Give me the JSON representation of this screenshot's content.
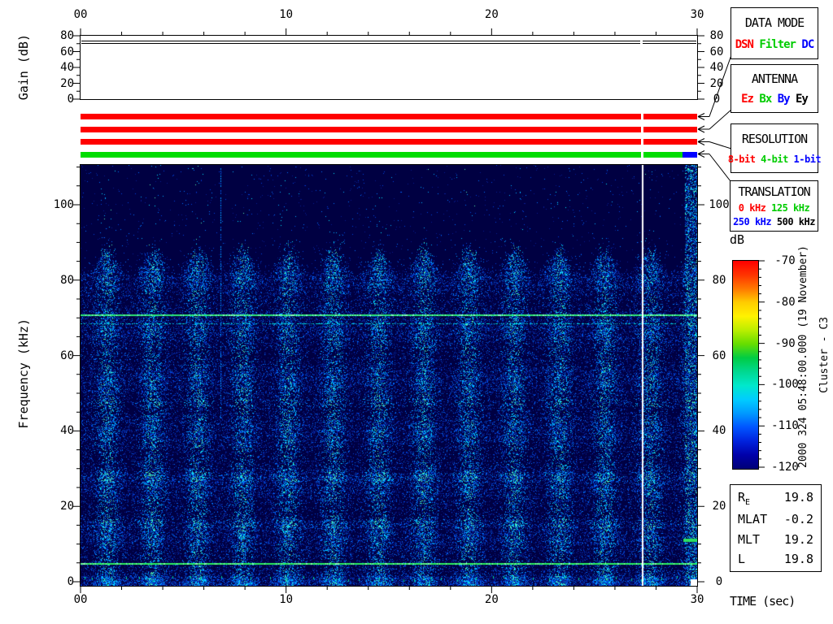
{
  "gain_panel": {
    "ylabel": "Gain (dB)",
    "yticks": [
      "80",
      "60",
      "40",
      "20",
      "0"
    ],
    "gain_trace_db": [
      74,
      70.5
    ]
  },
  "time_axis": {
    "ticks": [
      "00",
      "10",
      "20",
      "30"
    ],
    "range_sec": [
      0,
      30
    ],
    "minor_step_sec": 2
  },
  "mode_bars": {
    "gap_time_sec": 27.3,
    "bars": [
      {
        "name": "data-mode-bar",
        "active": "DSN",
        "color": "#ff0000"
      },
      {
        "name": "antenna-bar",
        "active": "Ez",
        "color": "#ff0000"
      },
      {
        "name": "resolution-bar",
        "active": "8-bit",
        "color": "#ff0000"
      },
      {
        "name": "translation-bar",
        "active": "125 kHz",
        "color": "#00dd00",
        "end_segment": {
          "active": "250 kHz",
          "color": "#0000ff",
          "start_sec": 29.3
        }
      }
    ]
  },
  "info_boxes": {
    "data_mode": {
      "title": "DATA MODE",
      "options": [
        {
          "label": "DSN",
          "color": "#ff0000"
        },
        {
          "label": "Filter",
          "color": "#00cc00"
        },
        {
          "label": "DC",
          "color": "#0000ff"
        }
      ]
    },
    "antenna": {
      "title": "ANTENNA",
      "options": [
        {
          "label": "Ez",
          "color": "#ff0000"
        },
        {
          "label": "Bx",
          "color": "#00cc00"
        },
        {
          "label": "By",
          "color": "#0000ff"
        },
        {
          "label": "Ey",
          "color": "#000000"
        }
      ]
    },
    "resolution": {
      "title": "RESOLUTION",
      "options": [
        {
          "label": "8-bit",
          "color": "#ff0000"
        },
        {
          "label": "4-bit",
          "color": "#00cc00"
        },
        {
          "label": "1-bit",
          "color": "#0000ff"
        }
      ]
    },
    "translation": {
      "title": "TRANSLATION",
      "options": [
        {
          "label": "0 kHz",
          "color": "#ff0000"
        },
        {
          "label": "125 kHz",
          "color": "#00cc00"
        },
        {
          "label": "250 kHz",
          "color": "#0000ff"
        },
        {
          "label": "500 kHz",
          "color": "#000000"
        }
      ]
    }
  },
  "colorbar": {
    "label": "dB",
    "ticks": [
      "-70",
      "-80",
      "-90",
      "-100",
      "-110",
      "-120"
    ],
    "max_db": -70,
    "min_db": -120,
    "gradient": [
      "#ff0000",
      "#ff3300",
      "#ff7700",
      "#ffcc00",
      "#fff200",
      "#bbee00",
      "#66dd00",
      "#00cc44",
      "#00d890",
      "#00e8cc",
      "#00ccff",
      "#0099ff",
      "#0055ff",
      "#0022dd",
      "#0000aa",
      "#000077"
    ]
  },
  "side_annotations": {
    "datetime": "2000 324 05:48:00.000 (19 November)",
    "spacecraft": "Cluster - C3"
  },
  "ephemeris": {
    "rows": [
      {
        "label": "R",
        "subscript": "E",
        "value": "19.8"
      },
      {
        "label": "MLAT",
        "subscript": "",
        "value": "-0.2"
      },
      {
        "label": "MLT",
        "subscript": "",
        "value": "19.2"
      },
      {
        "label": "L",
        "subscript": "",
        "value": "19.8"
      }
    ]
  },
  "spectrogram": {
    "xlabel": "TIME (sec)",
    "ylabel": "Frequency (kHz)",
    "xticks": [
      "00",
      "10",
      "20",
      "30"
    ],
    "yticks": [
      "100",
      "80",
      "60",
      "40",
      "20",
      "0"
    ],
    "background_color": "#000042",
    "white_marker_sec": 27.3
  },
  "chart_data": [
    {
      "type": "line",
      "title": "Receiver gain vs time",
      "xlabel": "TIME (sec)",
      "ylabel": "Gain (dB)",
      "x_range": [
        0,
        30
      ],
      "y_range": [
        0,
        80
      ],
      "series": [
        {
          "name": "gain_db",
          "x": [
            0,
            30
          ],
          "y": [
            74,
            74
          ]
        },
        {
          "name": "gain_db_lower",
          "x": [
            0,
            30
          ],
          "y": [
            70.5,
            70.5
          ]
        }
      ]
    },
    {
      "type": "heatmap",
      "title": "Cluster C3 WBD wideband spectrogram, 2000-324 05:48:00.000 (19 November)",
      "xlabel": "TIME (sec)",
      "ylabel": "Frequency (kHz)",
      "zlabel": "dB",
      "x_range": [
        0,
        30
      ],
      "y_range": [
        0,
        110
      ],
      "z_range": [
        -120,
        -70
      ],
      "features": [
        "broadband impulsive bursts recurring every ~2.2 s filling 0-85 kHz",
        "dark background near -120 dB above ~85 kHz noise ceiling",
        "narrowband emission line at ~71 kHz across all times",
        "weaker narrowband line at ~68.5 kHz",
        "narrowband emission line at ~5 kHz across all times",
        "vertical white marker line at t = 27.3 s",
        "faint vertical interference spike at t = 6.8 s up to 110 kHz",
        "enhanced broadband burst column at t = 29.5-30 s",
        "short emission segment at ~11.5 kHz, t = 29.3-30 s",
        "translation switches 125 kHz -> 250 kHz at t = 29.3 s (status bar)"
      ]
    }
  ]
}
